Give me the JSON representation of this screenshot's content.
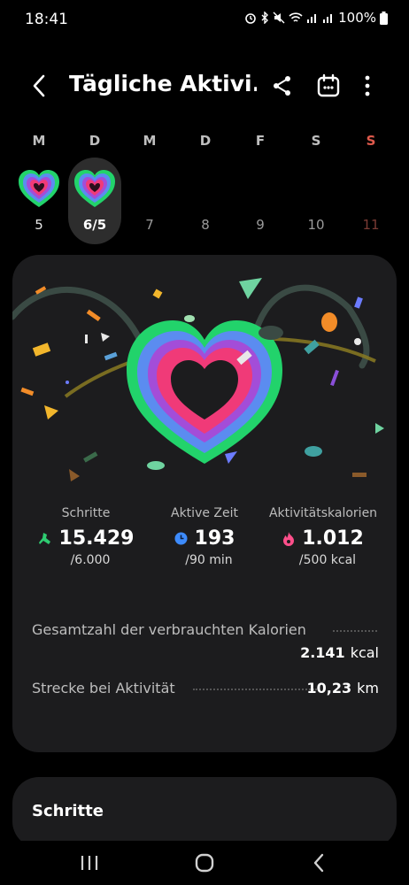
{
  "status_bar": {
    "time": "18:41",
    "battery": "100%",
    "icons": [
      "alarm-icon",
      "bluetooth-icon",
      "mute-icon",
      "wifi-icon",
      "signal-icon",
      "signal-icon",
      "battery-icon"
    ]
  },
  "header": {
    "title": "Tägliche Aktivi...",
    "icons": [
      "back-arrow-icon",
      "share-icon",
      "calendar-icon",
      "more-vert-icon"
    ]
  },
  "week": {
    "days": [
      {
        "label": "M",
        "num": "5"
      },
      {
        "label": "D",
        "num": "6/5"
      },
      {
        "label": "M",
        "num": "7"
      },
      {
        "label": "D",
        "num": "8"
      },
      {
        "label": "F",
        "num": "9"
      },
      {
        "label": "S",
        "num": "10"
      },
      {
        "label": "S",
        "num": "11"
      }
    ]
  },
  "stats": [
    {
      "label": "Schritte",
      "value": "15.429",
      "goal": "/6.000",
      "icon": "shoe-icon",
      "color": "#2ecc71"
    },
    {
      "label": "Aktive Zeit",
      "value": "193",
      "goal": "/90 min",
      "icon": "clock-icon",
      "color": "#3d8bfd"
    },
    {
      "label": "Aktivitätskalorien",
      "value": "1.012",
      "goal": "/500 kcal",
      "icon": "flame-icon",
      "color": "#ff4f8b"
    }
  ],
  "details": {
    "total_calories": {
      "label": "Gesamtzahl der verbrauchten Kalorien",
      "value": "2.141",
      "unit": "kcal"
    },
    "distance": {
      "label": "Strecke bei Aktivität",
      "value": "10,23",
      "unit": "km"
    }
  },
  "steps_card": {
    "title": "Schritte"
  },
  "colors": {
    "background": "#000000",
    "card": "#1c1c1e",
    "ring_green": "#22d36b",
    "ring_blue": "#5b8cf0",
    "ring_pink": "#f03a78"
  }
}
